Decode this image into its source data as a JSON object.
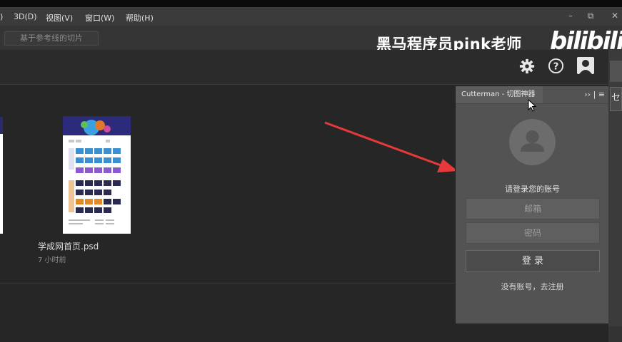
{
  "menu": {
    "paren": ")",
    "items": [
      "3D(D)",
      "视图(V)",
      "窗口(W)",
      "帮助(H)"
    ]
  },
  "window_controls": {
    "minimize": "–",
    "restore": "⧉",
    "close": "✕"
  },
  "options_bar": {
    "slice_button": "基于参考线的切片"
  },
  "watermark": {
    "text": "黑马程序员pink老师",
    "logo": "bilibili"
  },
  "header_icons": [
    "gear-icon",
    "help-icon",
    "user-avatar-icon"
  ],
  "files": [
    {
      "name": "学成网首页.psd",
      "time": "7 小时前"
    }
  ],
  "plugin_panel": {
    "tab_title": "Cutterman - 切图神器",
    "menu_glyphs": "›› | ≡",
    "login_title": "请登录您的账号",
    "email_placeholder": "邮箱",
    "password_placeholder": "密码",
    "login_button": "登 录",
    "register_text": "没有账号，去注册"
  },
  "right_strip": {
    "tool_char": "セ"
  },
  "colors": {
    "arrow": "#e8393a",
    "panel_bg": "#535353",
    "app_bg": "#262626"
  }
}
